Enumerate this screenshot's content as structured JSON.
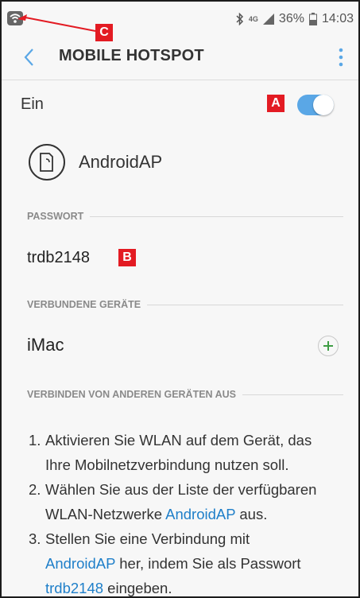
{
  "status_bar": {
    "network_type": "4G",
    "battery_percent": "36%",
    "time": "14:03",
    "icons": [
      "hotspot-icon",
      "bluetooth-icon",
      "signal-icon",
      "battery-icon"
    ]
  },
  "annotations": {
    "a": "A",
    "b": "B",
    "c": "C"
  },
  "app_bar": {
    "title": "MOBILE HOTSPOT"
  },
  "hotspot": {
    "label": "Ein",
    "enabled": true
  },
  "network": {
    "name": "AndroidAP"
  },
  "password": {
    "header": "PASSWORT",
    "value": "trdb2148"
  },
  "devices": {
    "header": "VERBUNDENE GERÄTE",
    "items": [
      {
        "name": "iMac"
      }
    ]
  },
  "instructions": {
    "header": "VERBINDEN VON ANDEREN GERÄTEN AUS",
    "steps": [
      {
        "num": "1.",
        "line1": "Aktivieren Sie WLAN auf dem Gerät, das",
        "line2": "Ihre Mobilnetzverbindung nutzen soll."
      },
      {
        "num": "2.",
        "line1": "Wählen Sie aus der Liste der verfügbaren",
        "line2_pre": "WLAN-Netzwerke ",
        "line2_link": "AndroidAP",
        "line2_post": " aus."
      },
      {
        "num": "3.",
        "line1": "Stellen Sie eine Verbindung mit",
        "line2_link": "AndroidAP",
        "line2_post": " her, indem Sie als Passwort",
        "line3_link": "trdb2148",
        "line3_post": " eingeben."
      }
    ]
  },
  "colors": {
    "accent": "#5aa7e6",
    "link": "#1f7fc9",
    "badge": "#e31b23",
    "add": "#3f9d45"
  }
}
